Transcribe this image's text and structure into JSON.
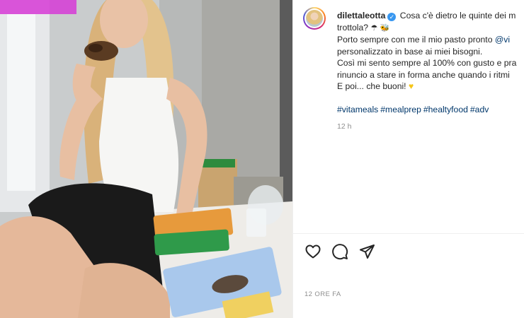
{
  "post": {
    "username": "dilettaleotta",
    "caption_lines": [
      "Cosa c'è dietro le quinte dei m",
      "trottola? ",
      "Porto sempre con me il mio pasto pronto ",
      "personalizzato in base ai miei bisogni.",
      "Così mi sento sempre al 100% con gusto e pra",
      "rinuncio a stare in forma anche quando i ritmi",
      "E poi... che buoni! "
    ],
    "mention": "@vi",
    "hashtags": [
      "#vitameals",
      "#mealprep",
      "#healtyfood",
      "#adv"
    ],
    "relative_time": "12 h",
    "post_time": "12 ORE FA"
  },
  "icons": {
    "verified": "verified-badge-icon",
    "emoji_1": "umbrella-icon",
    "emoji_2": "bee-icon",
    "emoji_heart": "yellow-heart-icon",
    "like": "heart-icon",
    "comment": "comment-icon",
    "share": "send-icon"
  },
  "colors": {
    "link": "#00376b",
    "verified": "#3897f0",
    "secondary_text": "#8e8e8e"
  }
}
